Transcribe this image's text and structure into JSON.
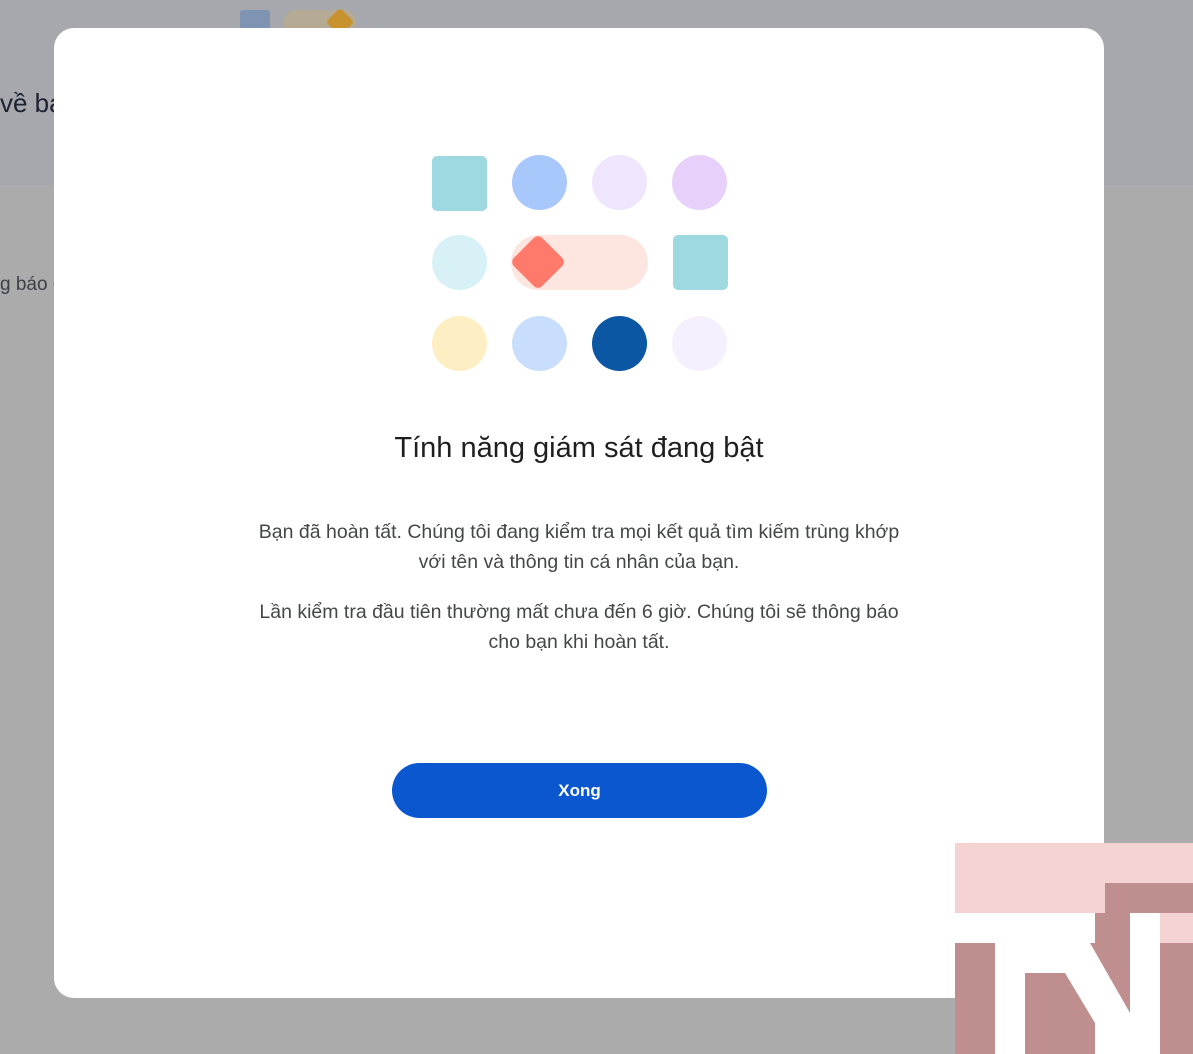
{
  "background": {
    "heading_fragment": "về ba",
    "subtext_fragment": "g báo c"
  },
  "dialog": {
    "title": "Tính năng giám sát đang bật",
    "paragraph_1": "Bạn đã hoàn tất. Chúng tôi đang kiểm tra mọi kết quả tìm kiếm trùng khớp với tên và thông tin cá nhân của bạn.",
    "paragraph_2": "Lần kiểm tra đầu tiên thường mất chưa đến 6 giờ. Chúng tôi sẽ thông báo cho bạn khi hoàn tất.",
    "done_button_label": "Xong"
  },
  "colors": {
    "primary_button": "#0b57d0",
    "illustration_teal": "#9ed8e0",
    "illustration_blue": "#a8c7fa",
    "illustration_coral": "#ff7a6b",
    "illustration_dark_blue": "#0b57a3",
    "overlay": "#ababab"
  }
}
